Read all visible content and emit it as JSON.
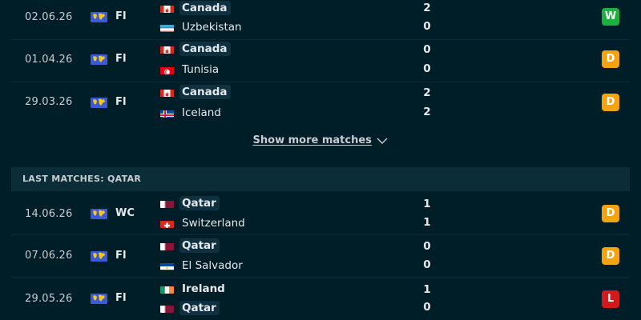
{
  "show_more_label": "Show more matches",
  "section_header": "LAST MATCHES: QATAR",
  "colors": {
    "win": "#1bb13c",
    "draw": "#f2a30f",
    "loss": "#d11a1a",
    "background": "#001e28"
  },
  "rows": [
    {
      "date": "02.06.26",
      "comp": "FI",
      "home": "Canada",
      "away": "Uzbekistan",
      "home_score": "2",
      "away_score": "0",
      "result": "W"
    },
    {
      "date": "01.04.26",
      "comp": "FI",
      "home": "Canada",
      "away": "Tunisia",
      "home_score": "0",
      "away_score": "0",
      "result": "D"
    },
    {
      "date": "29.03.26",
      "comp": "FI",
      "home": "Canada",
      "away": "Iceland",
      "home_score": "2",
      "away_score": "2",
      "result": "D"
    },
    {
      "date": "14.06.26",
      "comp": "WC",
      "home": "Qatar",
      "away": "Switzerland",
      "home_score": "1",
      "away_score": "1",
      "result": "D"
    },
    {
      "date": "07.06.26",
      "comp": "FI",
      "home": "Qatar",
      "away": "El Salvador",
      "home_score": "0",
      "away_score": "0",
      "result": "D"
    },
    {
      "date": "29.05.26",
      "comp": "FI",
      "home": "Ireland",
      "away": "Qatar",
      "home_score": "1",
      "away_score": "0",
      "result": "L"
    }
  ]
}
